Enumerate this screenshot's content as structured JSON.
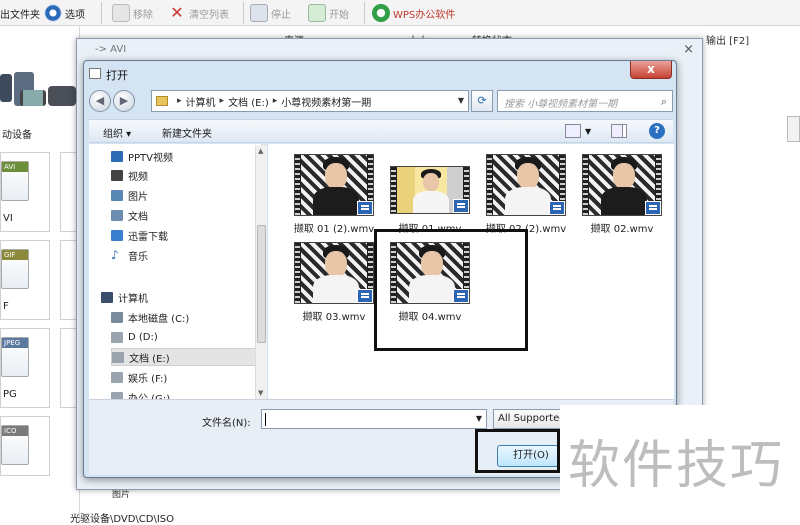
{
  "toolbar": {
    "output_folder": "出文件夹",
    "options": "选项",
    "remove": "移除",
    "clear_list": "清空列表",
    "stop": "停止",
    "start": "开始",
    "wps": "WPS办公软件"
  },
  "background": {
    "col_source": "来源",
    "col_size": "大小",
    "col_status": "转换状态",
    "col_output": "输出 [F2]",
    "mobile_devices": "动设备",
    "formats": [
      {
        "tag": "AVI",
        "label": "VI"
      },
      {
        "tag": "GIF",
        "label": "F"
      },
      {
        "tag": "JPEG",
        "label": "PG"
      },
      {
        "tag": "ICO",
        "label": ""
      }
    ],
    "small_label": "图片",
    "bottom_category": "光驱设备\\DVD\\CD\\ISO"
  },
  "avi_window": {
    "title": "-> AVI",
    "close": "×"
  },
  "dialog": {
    "title": "打开",
    "close": "x",
    "address": {
      "parts": [
        "计算机",
        "文档 (E:)",
        "小尊视频素材第一期"
      ]
    },
    "search_placeholder": "搜索 小尊视频素材第一期",
    "commands": {
      "organize": "组织 ▾",
      "new_folder": "新建文件夹"
    },
    "nav_items": [
      {
        "label": "PPTV视频",
        "color": "#2b6cb5"
      },
      {
        "label": "视频",
        "color": "#444"
      },
      {
        "label": "图片",
        "color": "#5a88b5"
      },
      {
        "label": "文档",
        "color": "#6d8db0"
      },
      {
        "label": "迅雷下载",
        "color": "#3a7fcf"
      },
      {
        "label": "音乐",
        "color": "#2d6db8"
      },
      {
        "label": "计算机",
        "color": "#3b4f6c"
      },
      {
        "label": "本地磁盘 (C:)",
        "color": "#7a8a9a"
      },
      {
        "label": "D (D:)",
        "color": "#9aa4ae"
      },
      {
        "label": "文档 (E:)",
        "color": "#9aa4ae"
      },
      {
        "label": "娱乐 (F:)",
        "color": "#9aa4ae"
      },
      {
        "label": "办公 (G:)",
        "color": "#9aa4ae"
      }
    ],
    "files": [
      {
        "name": "撷取 01 (2).wmv"
      },
      {
        "name": "撷取 01.wmv"
      },
      {
        "name": "撷取 02 (2).wmv"
      },
      {
        "name": "撷取 02.wmv"
      },
      {
        "name": "撷取 03.wmv"
      },
      {
        "name": "撷取 04.wmv"
      }
    ],
    "filename_label": "文件名(N):",
    "filename_value": "",
    "filetype": "All Supported",
    "open_button": "打开(O)"
  },
  "watermark": "软件技巧",
  "colors": {
    "accent": "#2c65b3",
    "dialog_bg": "#d5e4f3",
    "close_red": "#c74235"
  }
}
